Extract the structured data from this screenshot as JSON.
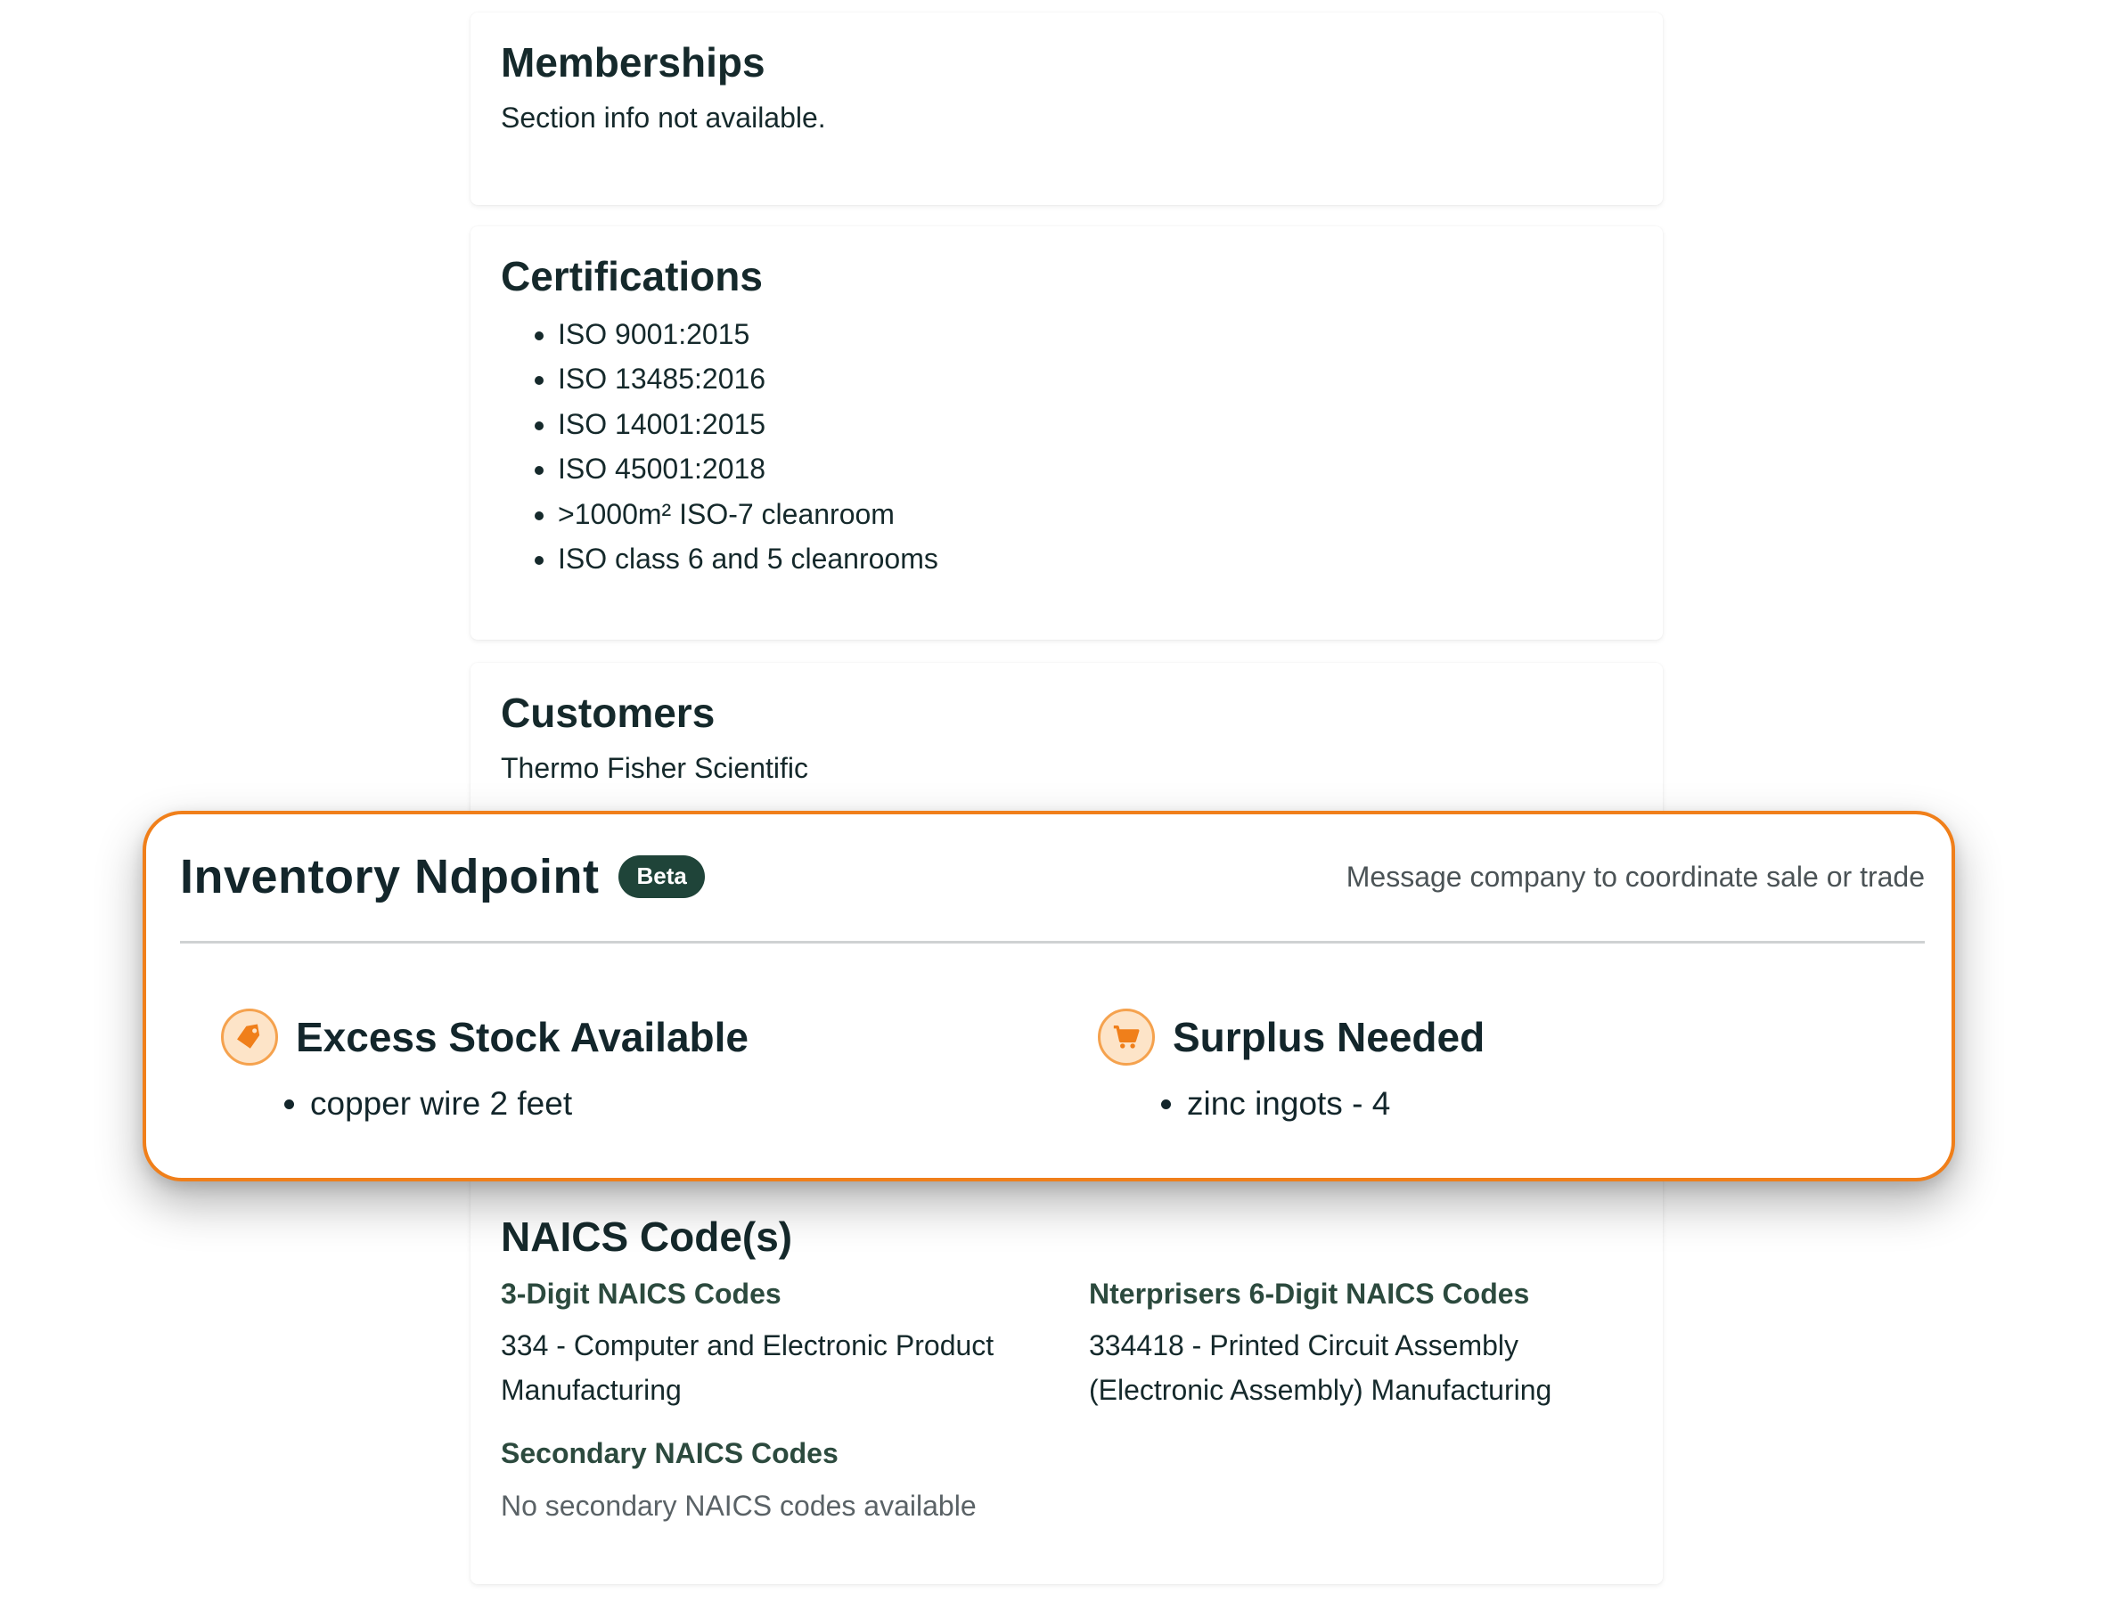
{
  "memberships": {
    "title": "Memberships",
    "text": "Section info not available."
  },
  "certifications": {
    "title": "Certifications",
    "items": [
      "ISO 9001:2015",
      "ISO 13485:2016",
      "ISO 14001:2015",
      "ISO 45001:2018",
      ">1000m² ISO-7 cleanroom",
      "ISO class 6 and 5 cleanrooms"
    ]
  },
  "customers": {
    "title": "Customers",
    "text": "Thermo Fisher Scientific"
  },
  "inventory": {
    "title": "Inventory Ndpoint",
    "badge": "Beta",
    "note": "Message company to coordinate sale or trade",
    "excess": {
      "title": "Excess Stock Available",
      "icon": "price-tag-icon",
      "items": [
        "copper wire 2 feet"
      ]
    },
    "surplus": {
      "title": "Surplus Needed",
      "icon": "shopping-cart-icon",
      "items": [
        "zinc ingots - 4"
      ]
    },
    "accent_color": "#f07f1a",
    "badge_color": "#1f4439"
  },
  "naics": {
    "title": "NAICS Code(s)",
    "three_digit_heading": "3-Digit NAICS Codes",
    "three_digit_value": "334 - Computer and Electronic Product Manufacturing",
    "six_digit_heading": "Nterprisers 6-Digit NAICS Codes",
    "six_digit_value": "334418 - Printed Circuit Assembly (Electronic Assembly) Manufacturing",
    "secondary_heading": "Secondary NAICS Codes",
    "secondary_value": "No secondary NAICS codes available"
  }
}
